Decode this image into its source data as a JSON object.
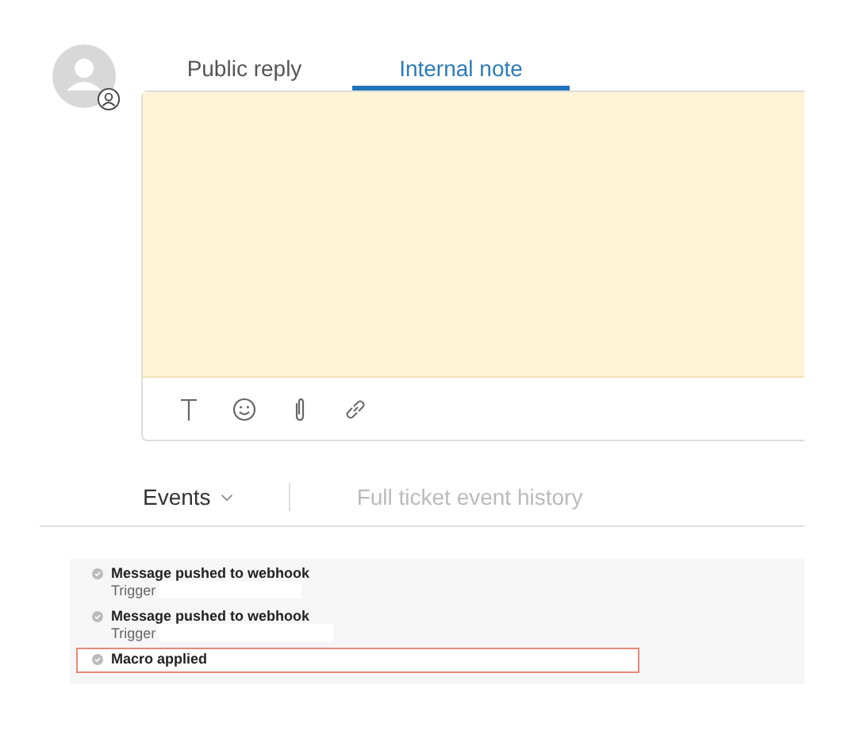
{
  "tabs": [
    {
      "label": "Public reply",
      "selected": false
    },
    {
      "label": "Internal note",
      "selected": true
    }
  ],
  "events_header": {
    "filter": "Events",
    "link": "Full ticket event history"
  },
  "events": [
    {
      "title": "Message pushed to webhook",
      "detail": "Trigger",
      "highlighted": false
    },
    {
      "title": "Message pushed to webhook",
      "detail": "Trigger",
      "highlighted": false
    },
    {
      "title": "Macro applied",
      "highlighted": true
    }
  ]
}
